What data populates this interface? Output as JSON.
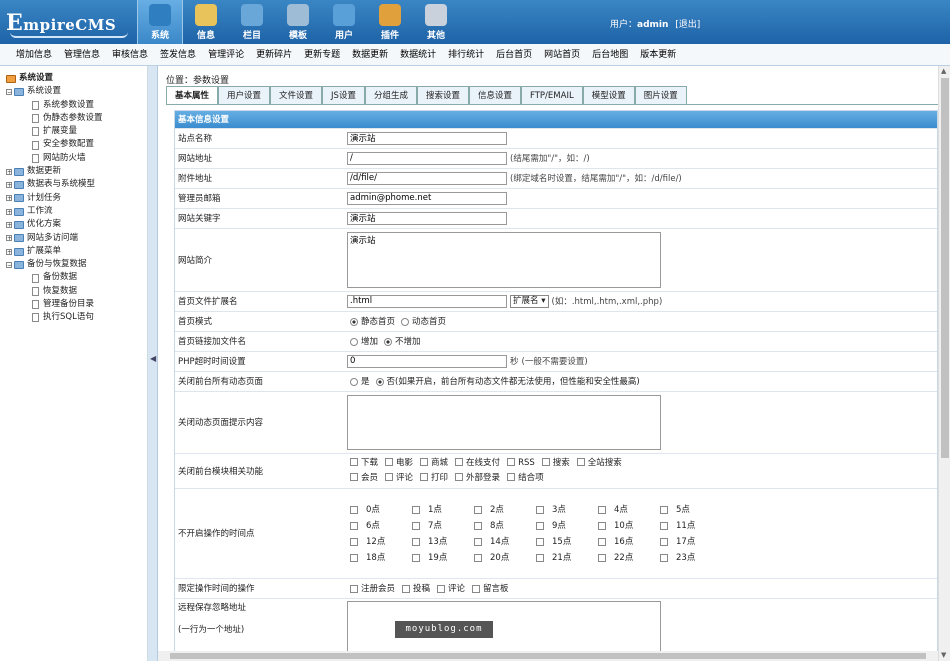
{
  "brand": {
    "logo_first": "E",
    "logo_rest": "mpireCMS"
  },
  "nav": [
    {
      "label": "系统",
      "icon": "globe-icon",
      "color": "#2f7fc0",
      "active": true
    },
    {
      "label": "信息",
      "icon": "pencil-icon",
      "color": "#e8c25a"
    },
    {
      "label": "栏目",
      "icon": "folder-icon",
      "color": "#6aa7d9"
    },
    {
      "label": "模板",
      "icon": "window-icon",
      "color": "#9fbcd6"
    },
    {
      "label": "用户",
      "icon": "user-icon",
      "color": "#5aa0d8"
    },
    {
      "label": "插件",
      "icon": "tools-icon",
      "color": "#e0a03c"
    },
    {
      "label": "其他",
      "icon": "gear-icon",
      "color": "#c9d2dc"
    }
  ],
  "user": {
    "prefix": "用户：",
    "name": "admin",
    "logout": "[退出]"
  },
  "subnav": [
    "增加信息",
    "管理信息",
    "审核信息",
    "签发信息",
    "管理评论",
    "更新碎片",
    "更新专题",
    "数据更新",
    "数据统计",
    "排行统计",
    "后台首页",
    "网站首页",
    "后台地图",
    "版本更新"
  ],
  "tree": [
    {
      "label": "系统设置",
      "type": "root"
    },
    {
      "label": "系统设置",
      "type": "open"
    },
    {
      "label": "系统参数设置",
      "type": "doc"
    },
    {
      "label": "伪静态参数设置",
      "type": "doc"
    },
    {
      "label": "扩展变量",
      "type": "doc"
    },
    {
      "label": "安全参数配置",
      "type": "doc"
    },
    {
      "label": "网站防火墙",
      "type": "doc"
    },
    {
      "label": "数据更新",
      "type": "closed"
    },
    {
      "label": "数据表与系统模型",
      "type": "closed"
    },
    {
      "label": "计划任务",
      "type": "closed"
    },
    {
      "label": "工作流",
      "type": "closed"
    },
    {
      "label": "优化方案",
      "type": "closed"
    },
    {
      "label": "网站多访问端",
      "type": "closed"
    },
    {
      "label": "扩展菜单",
      "type": "closed"
    },
    {
      "label": "备份与恢复数据",
      "type": "open"
    },
    {
      "label": "备份数据",
      "type": "doc"
    },
    {
      "label": "恢复数据",
      "type": "doc"
    },
    {
      "label": "管理备份目录",
      "type": "doc"
    },
    {
      "label": "执行SQL语句",
      "type": "doc"
    }
  ],
  "breadcrumb": {
    "prefix": "位置：",
    "link": "参数设置"
  },
  "tabs": [
    "基本属性",
    "用户设置",
    "文件设置",
    "JS设置",
    "分组生成",
    "搜索设置",
    "信息设置",
    "FTP/EMAIL",
    "模型设置",
    "图片设置"
  ],
  "section_title": "基本信息设置",
  "form": {
    "site_name": {
      "label": "站点名称",
      "value": "演示站"
    },
    "site_url": {
      "label": "网站地址",
      "value": "/",
      "hint": "(结尾需加\"/\"，如：/)"
    },
    "attach_url": {
      "label": "附件地址",
      "value": "/d/file/",
      "hint": "(绑定域名时设置，结尾需加\"/\"，如：/d/file/)"
    },
    "admin_email": {
      "label": "管理员邮箱",
      "value": "admin@phome.net"
    },
    "keywords": {
      "label": "网站关键字",
      "value": "演示站"
    },
    "intro": {
      "label": "网站简介",
      "value": "演示站"
    },
    "index_ext": {
      "label": "首页文件扩展名",
      "value": ".html",
      "select": "扩展名",
      "hint": "(如：.html,.htm,.xml,.php)"
    },
    "index_mode": {
      "label": "首页模式",
      "opt1": "静态首页",
      "opt2": "动态首页"
    },
    "index_link": {
      "label": "首页链接加文件名",
      "opt1": "增加",
      "opt2": "不增加"
    },
    "php_timeout": {
      "label": "PHP超时时间设置",
      "value": "0",
      "unit": "秒",
      "hint": "(一般不需要设置)"
    },
    "close_dynamic": {
      "label": "关闭前台所有动态页面",
      "opt1": "是",
      "opt2": "否",
      "hint": "(如果开启，前台所有动态文件都无法使用，但性能和安全性最高)"
    },
    "close_msg": {
      "label": "关闭动态页面提示内容",
      "value": ""
    },
    "close_modules": {
      "label": "关闭前台模块相关功能",
      "items": [
        "下载",
        "电影",
        "商城",
        "在线支付",
        "RSS",
        "搜索",
        "全站搜索",
        "会员",
        "评论",
        "打印",
        "外部登录",
        "结合项"
      ]
    },
    "closed_hours": {
      "label": "不开启操作的时间点",
      "hours": [
        "0点",
        "1点",
        "2点",
        "3点",
        "4点",
        "5点",
        "6点",
        "7点",
        "8点",
        "9点",
        "10点",
        "11点",
        "12点",
        "13点",
        "14点",
        "15点",
        "16点",
        "17点",
        "18点",
        "19点",
        "20点",
        "21点",
        "22点",
        "23点"
      ]
    },
    "limited_ops": {
      "label": "限定操作时间的操作",
      "items": [
        "注册会员",
        "投稿",
        "评论",
        "留言板"
      ]
    },
    "remote_ignore": {
      "label": "远程保存忽略地址",
      "hint": "(一行为一个地址)",
      "value": ""
    }
  },
  "watermark": "moyublog.com"
}
